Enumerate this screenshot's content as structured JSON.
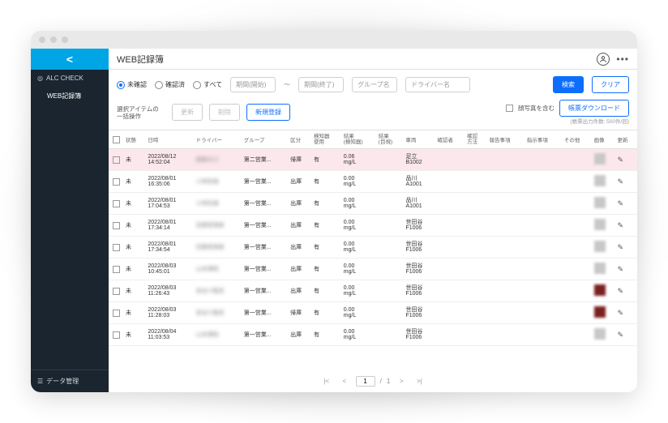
{
  "sidebar": {
    "alc_check": "ALC CHECK",
    "web_record": "WEB記録簿",
    "data_mgmt": "データ管理"
  },
  "header": {
    "title": "WEB記録簿"
  },
  "filters": {
    "unconfirmed": "未確認",
    "confirmed": "確認済",
    "all": "すべて",
    "period_start": "期間(開始)",
    "period_end": "期間(終了)",
    "group": "グループ名",
    "driver": "ドライバー名",
    "search": "検索",
    "clear": "クリア"
  },
  "toolbar": {
    "bulk_label": "選択アイテムの\n一括操作",
    "update": "更新",
    "delete": "削除",
    "new": "新規登録",
    "include_photo": "顔写真を含む",
    "download": "帳票ダウンロード",
    "note": "(帳票出力件数: 500件/回)"
  },
  "columns": {
    "status": "状態",
    "datetime": "日時",
    "driver": "ドライバー",
    "group": "グループ",
    "class": "区分",
    "detector_use": "検知器\n使用",
    "result_det": "結果\n(検知器)",
    "result_eye": "結果\n(目視)",
    "vehicle": "車両",
    "confirmer": "確認者",
    "method": "確認\n方法",
    "report": "報告事項",
    "instruct": "指示事項",
    "other": "その他",
    "image": "画像",
    "edit": "更新"
  },
  "rows": [
    {
      "status": "未",
      "dt": "2022/08/12\n14:52:04",
      "driver": "齋藤水口",
      "group": "第二営業...",
      "class": "帰庫",
      "det": "有",
      "res": "0.06\nmg/L",
      "veh": "足立\nB1002",
      "warn": true
    },
    {
      "status": "未",
      "dt": "2022/08/01\n16:35:06",
      "driver": "小林哲雄",
      "group": "第一営業...",
      "class": "出庫",
      "det": "有",
      "res": "0.00\nmg/L",
      "veh": "品川\nA1001"
    },
    {
      "status": "未",
      "dt": "2022/08/01\n17:04:53",
      "driver": "小林哲雄",
      "group": "第一営業...",
      "class": "出庫",
      "det": "有",
      "res": "0.00\nmg/L",
      "veh": "品川\nA1001"
    },
    {
      "status": "未",
      "dt": "2022/08/01\n17:34:14",
      "driver": "営業管理者",
      "group": "第一営業...",
      "class": "出庫",
      "det": "有",
      "res": "0.00\nmg/L",
      "veh": "世田谷\nF1006"
    },
    {
      "status": "未",
      "dt": "2022/08/01\n17:34:54",
      "driver": "営業管理者",
      "group": "第一営業...",
      "class": "出庫",
      "det": "有",
      "res": "0.00\nmg/L",
      "veh": "世田谷\nF1006"
    },
    {
      "status": "未",
      "dt": "2022/08/03\n10:45:01",
      "driver": "山本博昭",
      "group": "第一営業...",
      "class": "出庫",
      "det": "有",
      "res": "0.00\nmg/L",
      "veh": "世田谷\nF1006"
    },
    {
      "status": "未",
      "dt": "2022/08/03\n11:26:43",
      "driver": "長谷川隆吾",
      "group": "第一営業...",
      "class": "出庫",
      "det": "有",
      "res": "0.00\nmg/L",
      "veh": "世田谷\nF1006",
      "thumb": "red"
    },
    {
      "status": "未",
      "dt": "2022/08/03\n11:28:03",
      "driver": "長谷川隆吾",
      "group": "第一営業...",
      "class": "帰庫",
      "det": "有",
      "res": "0.00\nmg/L",
      "veh": "世田谷\nF1006",
      "thumb": "red"
    },
    {
      "status": "未",
      "dt": "2022/08/04\n11:03:53",
      "driver": "山本博昭",
      "group": "第一営業...",
      "class": "出庫",
      "det": "有",
      "res": "0.00\nmg/L",
      "veh": "世田谷\nF1006"
    }
  ],
  "pagination": {
    "page": "1",
    "total": "1"
  }
}
